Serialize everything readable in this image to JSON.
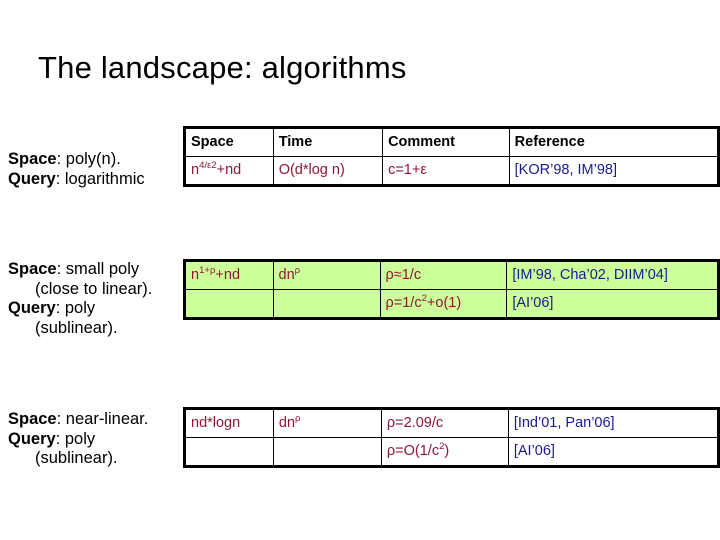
{
  "slide": {
    "title": "The landscape: algorithms"
  },
  "sections": [
    {
      "id": "poly-space",
      "desc_lines": [
        {
          "label": "Space",
          "rest": ": poly(n).",
          "indent": false
        },
        {
          "label": "Query",
          "rest": ": logarithmic",
          "indent": false
        }
      ],
      "table": {
        "headers": [
          "Space",
          "Time",
          "Comment",
          "Reference"
        ],
        "rows": [
          {
            "space": "n4/ε2+nd",
            "space_base": "n",
            "space_sup": "4/ε2",
            "space_tail": "+nd",
            "time": "O(d*log n)",
            "comment": "c=1+ε",
            "reference": "[KOR’98, IM’98]"
          }
        ]
      }
    },
    {
      "id": "small-poly-space",
      "desc_lines": [
        {
          "label": "Space",
          "rest": ": small poly",
          "indent": false
        },
        {
          "label": "",
          "rest": "(close to linear).",
          "indent": true
        },
        {
          "label": "Query",
          "rest": ": poly",
          "indent": false
        },
        {
          "label": "",
          "rest": "(sublinear).",
          "indent": true
        }
      ],
      "table": {
        "rows": [
          {
            "space_base": "n",
            "space_sup": "1+ρ",
            "space_tail": "+nd",
            "time_base": "dn",
            "time_sup": "ρ",
            "comment": "ρ≈1/c",
            "reference": "[IM’98, Cha’02, DIIM’04]"
          },
          {
            "space_base": "",
            "space_sup": "",
            "space_tail": "",
            "time_base": "",
            "time_sup": "",
            "comment_pre": "ρ=1/c",
            "comment_sup": "2",
            "comment_post": "+o(1)",
            "reference": "[AI’06]"
          }
        ]
      }
    },
    {
      "id": "near-linear-space",
      "desc_lines": [
        {
          "label": "Space",
          "rest": ": near-linear.",
          "indent": false
        },
        {
          "label": "Query",
          "rest": ": poly",
          "indent": false
        },
        {
          "label": "",
          "rest": "(sublinear).",
          "indent": true
        }
      ],
      "table": {
        "rows": [
          {
            "space": "nd*logn",
            "time_base": "dn",
            "time_sup": "ρ",
            "comment": "ρ=2.09/c",
            "reference": "[Ind’01, Pan’06]"
          },
          {
            "space": "",
            "time_base": "",
            "time_sup": "",
            "comment_pre": "ρ=O(1/c",
            "comment_sup": "2",
            "comment_post": ")",
            "reference": "[AI’06]"
          }
        ]
      }
    }
  ],
  "colors": {
    "formula": "#8c1836",
    "reference": "#1a1a8c",
    "highlight_row_bg": "#ccff99",
    "text": "#000000",
    "background": "#ffffff"
  }
}
